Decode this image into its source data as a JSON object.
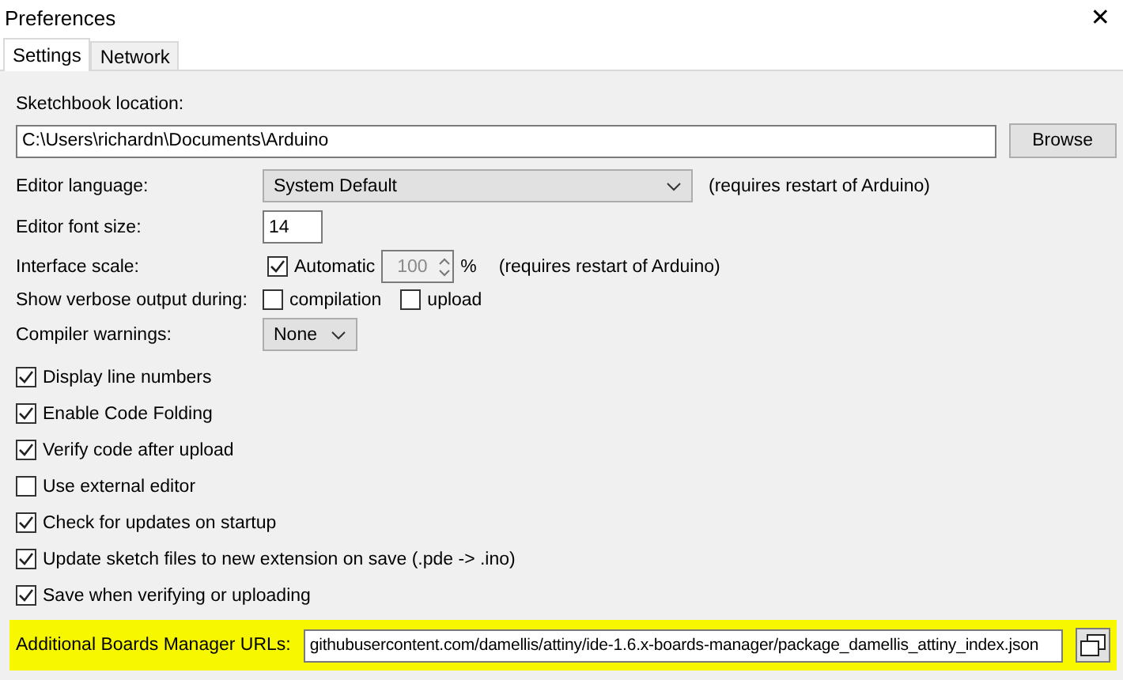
{
  "window": {
    "title": "Preferences",
    "close": "✕"
  },
  "tabs": [
    {
      "label": "Settings",
      "selected": true
    },
    {
      "label": "Network",
      "selected": false
    }
  ],
  "sketchbook": {
    "label": "Sketchbook location:",
    "value": "C:\\Users\\richardn\\Documents\\Arduino",
    "button": "Browse"
  },
  "editor_language": {
    "label": "Editor language:",
    "value": "System Default",
    "note": "(requires restart of Arduino)"
  },
  "font_size": {
    "label": "Editor font size:",
    "value": "14"
  },
  "interface_scale": {
    "label": "Interface scale:",
    "automatic": {
      "label": "Automatic",
      "checked": true
    },
    "value": "100",
    "disabled": true,
    "unit": "%",
    "note": "(requires restart of Arduino)"
  },
  "verbose": {
    "label": "Show verbose output during:",
    "options": [
      {
        "label": "compilation",
        "checked": false
      },
      {
        "label": "upload",
        "checked": false
      }
    ]
  },
  "compiler_warnings": {
    "label": "Compiler warnings:",
    "value": "None"
  },
  "options": [
    {
      "label": "Display line numbers",
      "checked": true
    },
    {
      "label": "Enable Code Folding",
      "checked": true
    },
    {
      "label": "Verify code after upload",
      "checked": true
    },
    {
      "label": "Use external editor",
      "checked": false
    },
    {
      "label": "Check for updates on startup",
      "checked": true
    },
    {
      "label": "Update sketch files to new extension on save (.pde -> .ino)",
      "checked": true
    },
    {
      "label": "Save when verifying or uploading",
      "checked": true
    }
  ],
  "additional_urls": {
    "label": "Additional Boards Manager URLs:",
    "value": "githubusercontent.com/damellis/attiny/ide-1.6.x-boards-manager/package_damellis_attiny_index.json",
    "highlighted": true
  }
}
